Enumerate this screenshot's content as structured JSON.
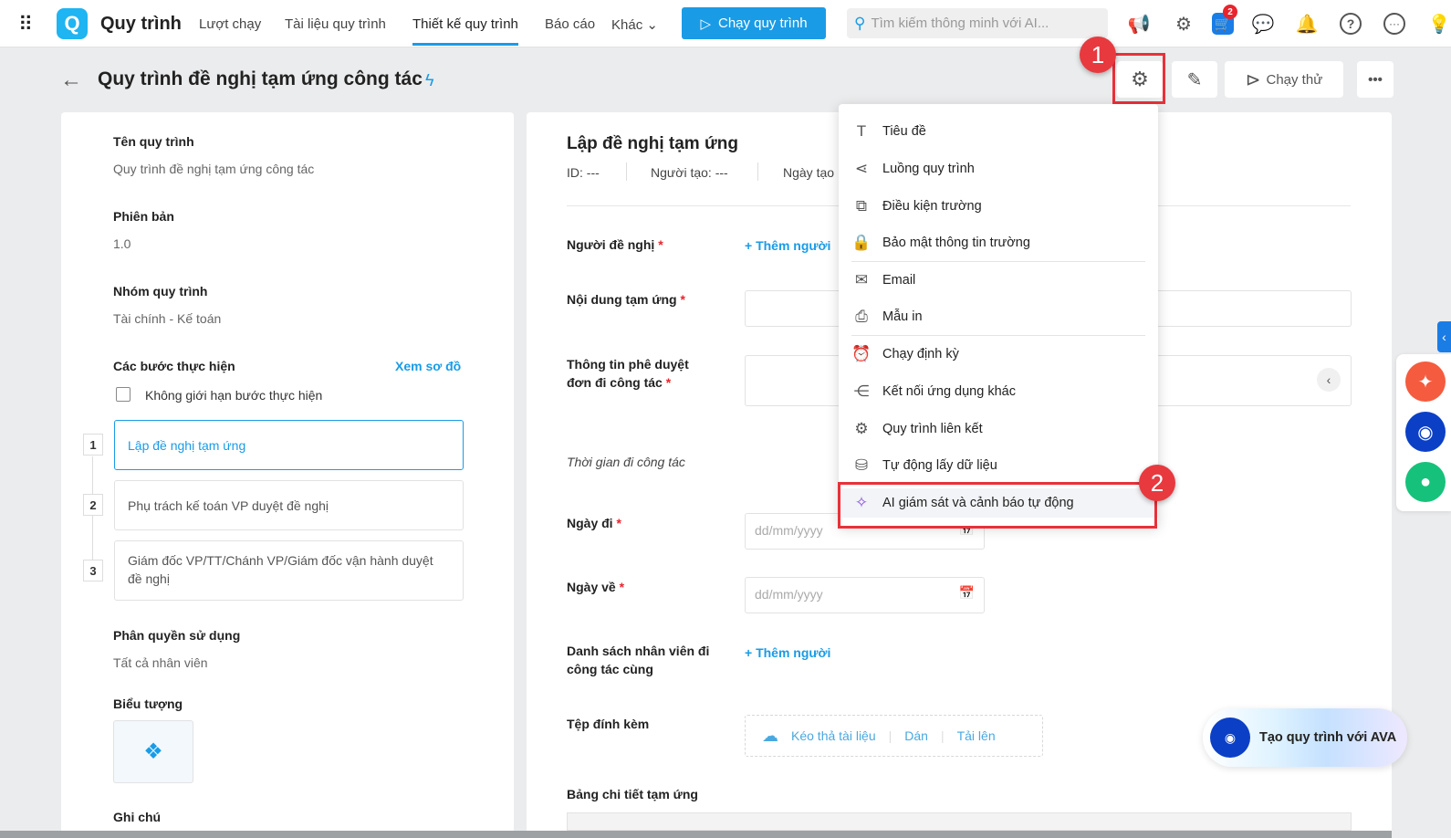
{
  "topbar": {
    "app_name": "Quy trình",
    "nav": [
      "Lượt chạy",
      "Tài liệu quy trình",
      "Thiết kế quy trình",
      "Báo cáo",
      "Khác"
    ],
    "run_button": "Chạy quy trình",
    "search_placeholder": "Tìm kiếm thông minh với AI...",
    "cart_badge": "2"
  },
  "header": {
    "title": "Quy trình đề nghị tạm ứng công tác",
    "try_run": "Chạy thử"
  },
  "left": {
    "name_label": "Tên quy trình",
    "name_value": "Quy trình đề nghị tạm ứng công tác",
    "version_label": "Phiên bản",
    "version_value": "1.0",
    "group_label": "Nhóm quy trình",
    "group_value": "Tài chính - Kế toán",
    "steps_label": "Các bước thực hiện",
    "view_diagram": "Xem sơ đồ",
    "unlimited_label": "Không giới hạn bước thực hiện",
    "steps": [
      {
        "num": "1",
        "label": "Lập đề nghị tạm ứng"
      },
      {
        "num": "2",
        "label": "Phụ trách kế toán VP duyệt đề nghị"
      },
      {
        "num": "3",
        "label": "Giám đốc VP/TT/Chánh VP/Giám đốc vận hành duyệt đề nghị"
      }
    ],
    "perm_label": "Phân quyền sử dụng",
    "perm_value": "Tất cả nhân viên",
    "icon_label": "Biểu tượng",
    "note_label": "Ghi chú"
  },
  "form": {
    "title": "Lập đề nghị tạm ứng",
    "id": "ID: ---",
    "creator": "Người tạo: ---",
    "created": "Ngày tạo",
    "requester": "Người đề nghị",
    "add_person": "+ Thêm người",
    "content": "Nội dung tạm ứng",
    "approval": "Thông tin phê duyệt đơn đi công tác",
    "period": "Thời gian đi công tác",
    "depart": "Ngày đi",
    "return": "Ngày về",
    "date_placeholder": "dd/mm/yyyy",
    "staff": "Danh sách nhân viên đi công tác cùng",
    "attach": "Tệp đính kèm",
    "drag": "Kéo thả tài liệu",
    "paste": "Dán",
    "upload": "Tải lên",
    "table": "Bảng chi tiết tạm ứng"
  },
  "menu": [
    "Tiêu đề",
    "Luồng quy trình",
    "Điều kiện trường",
    "Bảo mật thông tin trường",
    "Email",
    "Mẫu in",
    "Chạy định kỳ",
    "Kết nối ứng dụng khác",
    "Quy trình liên kết",
    "Tự động lấy dữ liệu",
    "AI giám sát và cảnh báo tự động"
  ],
  "callouts": [
    "1",
    "2"
  ],
  "ava": "Tạo quy trình với AVA"
}
